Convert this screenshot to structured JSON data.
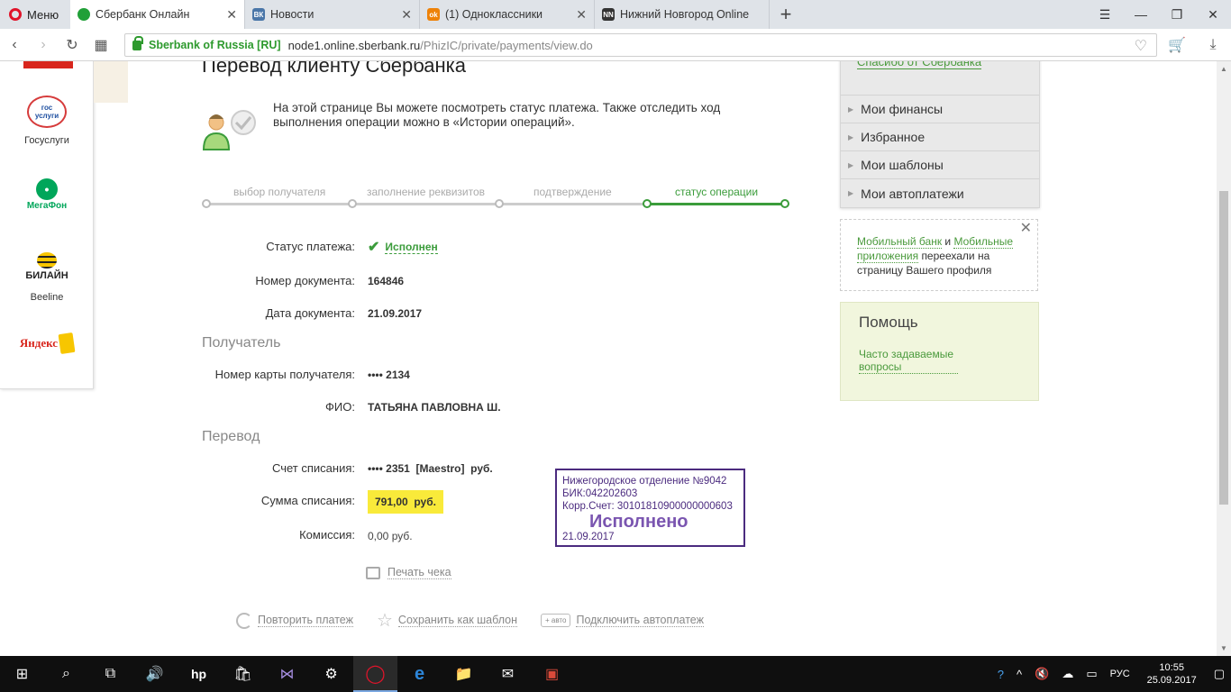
{
  "browser": {
    "menu_label": "Меню",
    "tabs": [
      {
        "title": "Сбербанк Онлайн",
        "active": true,
        "favicon_color": "#21a038",
        "favicon_text": ""
      },
      {
        "title": "Новости",
        "active": false,
        "favicon_color": "#4a76a8",
        "favicon_text": "ВК"
      },
      {
        "title": "(1) Одноклассники",
        "active": false,
        "favicon_color": "#ee8208",
        "favicon_text": "ok"
      },
      {
        "title": "Нижний Новгород Online",
        "active": false,
        "favicon_color": "#333333",
        "favicon_text": "NN"
      }
    ],
    "new_tab": "+",
    "org_name": "Sberbank of Russia [RU]",
    "url_host": "node1.online.sberbank.ru",
    "url_path": "/PhizIC/private/payments/view.do"
  },
  "page": {
    "title": "Перевод клиенту Сбербанка",
    "intro": "На этой странице Вы можете посмотреть статус платежа. Также отследить ход выполнения операции можно в «Истории операций».",
    "steps": [
      {
        "label": "выбор получателя",
        "state": "done"
      },
      {
        "label": "заполнение реквизитов",
        "state": "done"
      },
      {
        "label": "подтверждение",
        "state": "done"
      },
      {
        "label": "статус операции",
        "state": "active"
      }
    ],
    "status_label": "Статус платежа:",
    "status_value": "Исполнен",
    "doc_number_label": "Номер документа:",
    "doc_number": "164846",
    "doc_date_label": "Дата документа:",
    "doc_date": "21.09.2017",
    "recipient_section": "Получатель",
    "card_label": "Номер карты получателя:",
    "card_value": "•••• 2134",
    "fio_label": "ФИО:",
    "fio_value": "ТАТЬЯНА ПАВЛОВНА Ш.",
    "transfer_section": "Перевод",
    "account_label": "Счет списания:",
    "account_value": "•••• 2351  [Maestro]  руб.",
    "amount_label": "Сумма списания:",
    "amount_value": "791,00  руб.",
    "fee_label": "Комиссия:",
    "fee_value": "0,00 руб.",
    "print_label": "Печать чека",
    "actions": {
      "repeat": "Повторить платеж",
      "save_template": "Сохранить как шаблон",
      "auto_badge": "+ авто",
      "autopay": "Подключить автоплатеж"
    },
    "stamp": {
      "line1": "Нижегородское отделение №9042",
      "line2": "БИК:042202603",
      "line3": "Корр.Счет: 30101810900000000603",
      "status": "Исполнено",
      "date": "21.09.2017"
    }
  },
  "partners": [
    {
      "name": "Госуслуги",
      "logo_text": "гос услуги"
    },
    {
      "name": "",
      "logo_text": "МегаФон"
    },
    {
      "name": "Beeline",
      "logo_text": "БИЛАЙН"
    },
    {
      "name": "",
      "logo_text": "Яндекс"
    }
  ],
  "sidebar": {
    "top_link": "Спасибо от Сбербанка",
    "items": [
      "Мои финансы",
      "Избранное",
      "Мои шаблоны",
      "Мои автоплатежи"
    ],
    "notice": {
      "link1": "Мобильный банк",
      "and": "и",
      "link2": "Мобильные приложения",
      "rest": "переехали на страницу Вашего профиля"
    },
    "help_title": "Помощь",
    "help_link": "Часто задаваемые вопросы"
  },
  "taskbar": {
    "lang": "РУС",
    "time": "10:55",
    "date": "25.09.2017"
  },
  "colors": {
    "sber_green": "#21a038",
    "highlight_yellow": "#f9ea3a",
    "stamp_purple": "#4b2b7f"
  }
}
